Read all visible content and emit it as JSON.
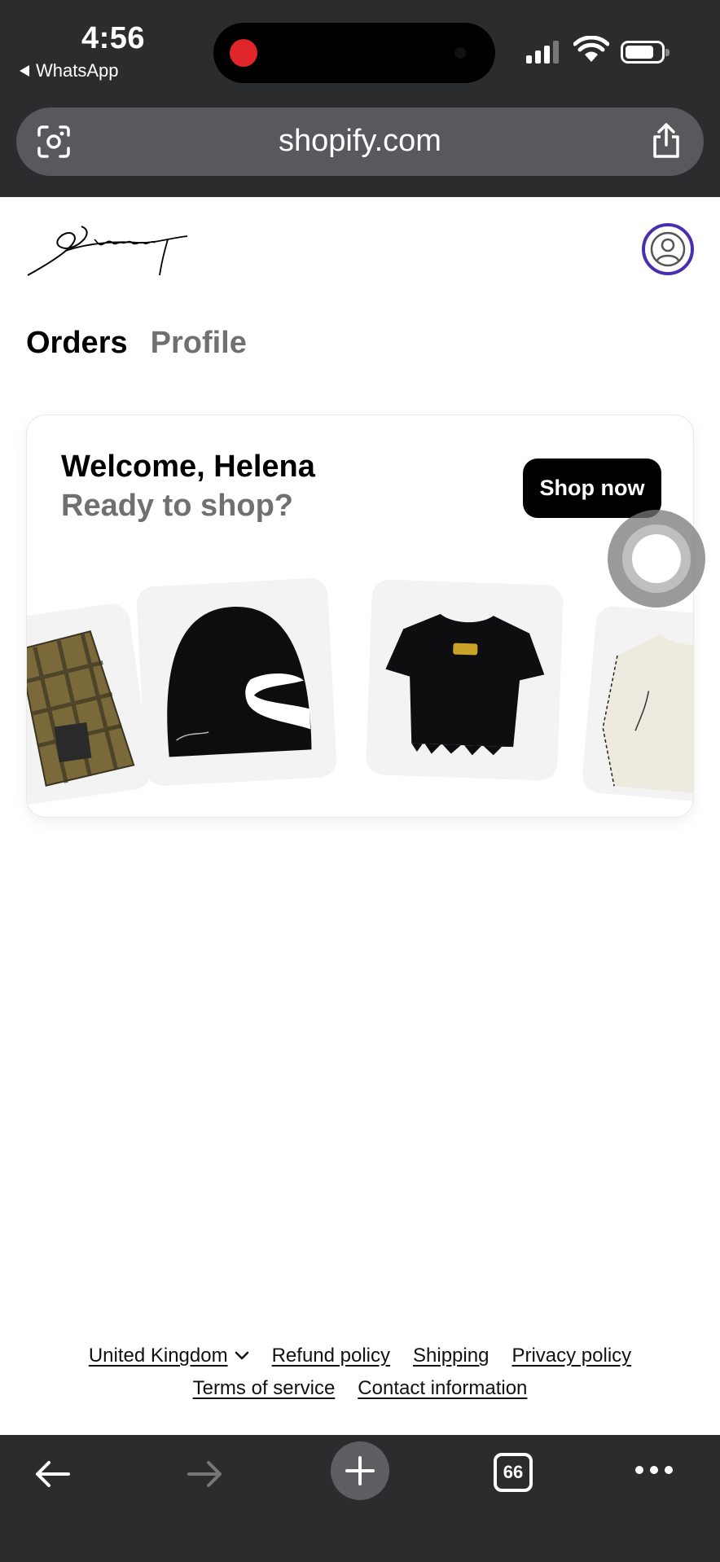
{
  "status_bar": {
    "time": "4:56",
    "back_app_label": "WhatsApp"
  },
  "browser": {
    "url": "shopify.com",
    "open_tabs_count": "66"
  },
  "header": {
    "logo_text": "Stonebway",
    "account_icon": "person-circle-icon"
  },
  "tabs": [
    {
      "label": "Orders",
      "active": true
    },
    {
      "label": "Profile",
      "active": false
    }
  ],
  "welcome_card": {
    "greeting": "Welcome, Helena",
    "subtitle": "Ready to shop?",
    "cta_label": "Shop now"
  },
  "footer": {
    "links_row1": [
      "United Kingdom",
      "Refund policy",
      "Shipping",
      "Privacy policy"
    ],
    "links_row2": [
      "Terms of service",
      "Contact information"
    ]
  },
  "colors": {
    "chrome_bg": "#2b2c2e",
    "url_bar_bg": "#58595d",
    "accent_purple": "#4b2eb0",
    "muted_text": "#707070"
  }
}
